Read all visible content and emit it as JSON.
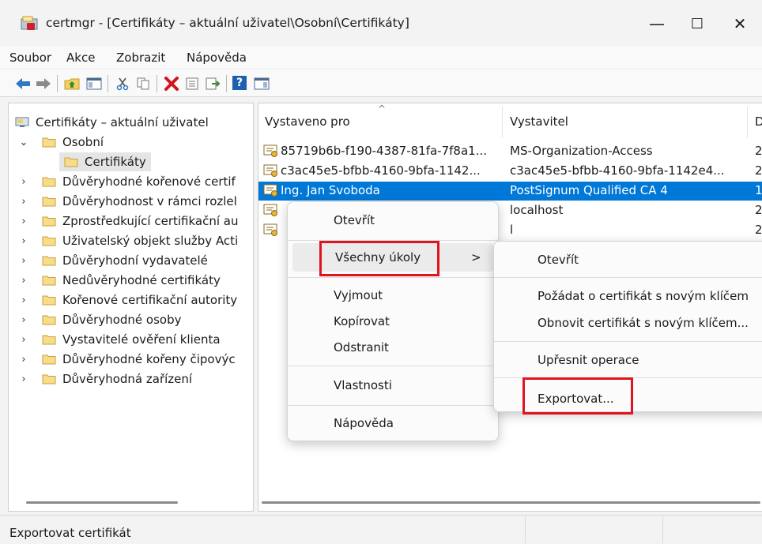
{
  "window": {
    "title": "certmgr - [Certifikáty – aktuální uživatel\\Osobní\\Certifikáty]",
    "min_glyph": "—",
    "max_glyph": "☐",
    "close_glyph": "✕"
  },
  "menu": [
    "Soubor",
    "Akce",
    "Zobrazit",
    "Nápověda"
  ],
  "toolbar": {
    "icons": [
      "back-arrow-icon",
      "forward-arrow-icon",
      "up-folder-icon",
      "show-hide-tree-icon",
      "cut-icon",
      "copy-icon",
      "delete-icon",
      "properties-icon",
      "export-list-icon",
      "help-icon",
      "action-pane-icon"
    ],
    "help_glyph": "?"
  },
  "tree": {
    "root": "Certifikáty – aktuální uživatel",
    "expanded": "Osobní",
    "selected_child": "Certifikáty",
    "items": [
      "Důvěryhodné kořenové certif",
      "Důvěryhodnost v rámci rozlel",
      "Zprostředkující certifikační au",
      "Uživatelský objekt služby Acti",
      "Důvěryhodní vydavatelé",
      "Nedůvěryhodné certifikáty",
      "Kořenové certifikační autority",
      "Důvěryhodné osoby",
      "Vystavitelé ověření klienta",
      "Důvěryhodné kořeny čipovýc",
      "Důvěryhodná zařízení"
    ],
    "collapse_glyph": "⌄",
    "expand_glyph": "›"
  },
  "list": {
    "columns": [
      "Vystaveno pro",
      "Vystavitel",
      "D"
    ],
    "sort_glyph": "^",
    "rows": [
      {
        "issued_to": "85719b6b-f190-4387-81fa-7f8a1...",
        "issuer": "MS-Organization-Access",
        "d": "2"
      },
      {
        "issued_to": "c3ac45e5-bfbb-4160-9bfa-1142...",
        "issuer": "c3ac45e5-bfbb-4160-9bfa-1142e4...",
        "d": "2"
      },
      {
        "issued_to": "Ing. Jan Svoboda",
        "issuer": "PostSignum Qualified CA 4",
        "d": "1",
        "selected": true
      },
      {
        "issued_to": "",
        "issuer": "localhost",
        "d": "2"
      },
      {
        "issued_to": "",
        "issuer": "l",
        "d": "2"
      }
    ]
  },
  "context_menu": {
    "items": [
      "Otevřít",
      "Všechny úkoly",
      "Vyjmout",
      "Kopírovat",
      "Odstranit",
      "Vlastnosti",
      "Nápověda"
    ],
    "submenu_arrow": ">"
  },
  "submenu": {
    "items": [
      "Otevřít",
      "Požádat o certifikát s novým klíčem",
      "Obnovit certifikát s novým klíčem...",
      "Upřesnit operace",
      "Exportovat..."
    ]
  },
  "status": "Exportovat certifikát",
  "colors": {
    "selection": "#0078d7",
    "highlight_box": "#e0141e"
  }
}
